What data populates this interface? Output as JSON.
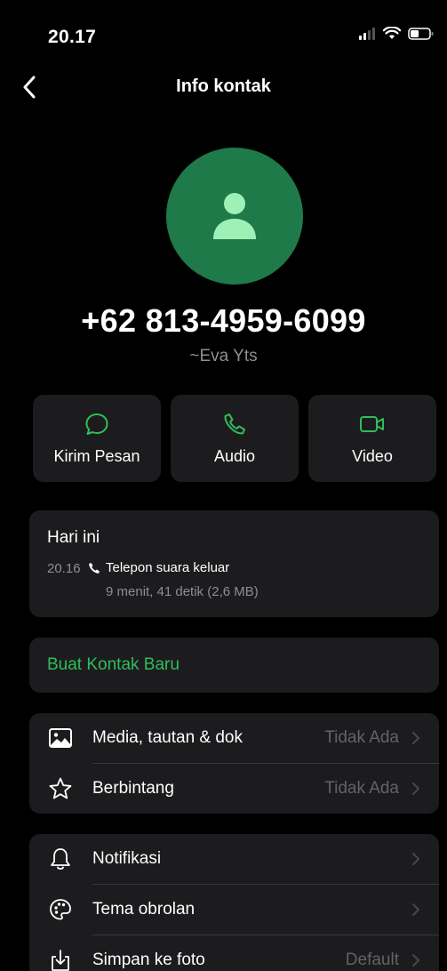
{
  "status_bar": {
    "time": "20.17"
  },
  "nav": {
    "title": "Info kontak"
  },
  "contact": {
    "phone": "+62 813-4959-6099",
    "name": "~Eva Yts"
  },
  "actions": [
    {
      "label": "Kirim Pesan",
      "icon": "message-icon"
    },
    {
      "label": "Audio",
      "icon": "phone-icon"
    },
    {
      "label": "Video",
      "icon": "video-icon"
    }
  ],
  "calls": {
    "title": "Hari ini",
    "items": [
      {
        "time": "20.16",
        "type": "Telepon suara keluar",
        "detail": "9 menit, 41 detik (2,6 MB)"
      }
    ]
  },
  "new_contact": {
    "label": "Buat Kontak Baru"
  },
  "list1": [
    {
      "label": "Media, tautan & dok",
      "value": "Tidak Ada",
      "icon": "photo-icon"
    },
    {
      "label": "Berbintang",
      "value": "Tidak Ada",
      "icon": "star-icon"
    }
  ],
  "list2": [
    {
      "label": "Notifikasi",
      "value": "",
      "icon": "bell-icon"
    },
    {
      "label": "Tema obrolan",
      "value": "",
      "icon": "palette-icon"
    },
    {
      "label": "Simpan ke foto",
      "value": "Default",
      "icon": "download-icon"
    }
  ],
  "colors": {
    "accent": "#2fbd5c",
    "avatar_bg": "#1f7a4a",
    "card_bg": "#1c1c1e",
    "secondary_text": "#8e8e93"
  }
}
